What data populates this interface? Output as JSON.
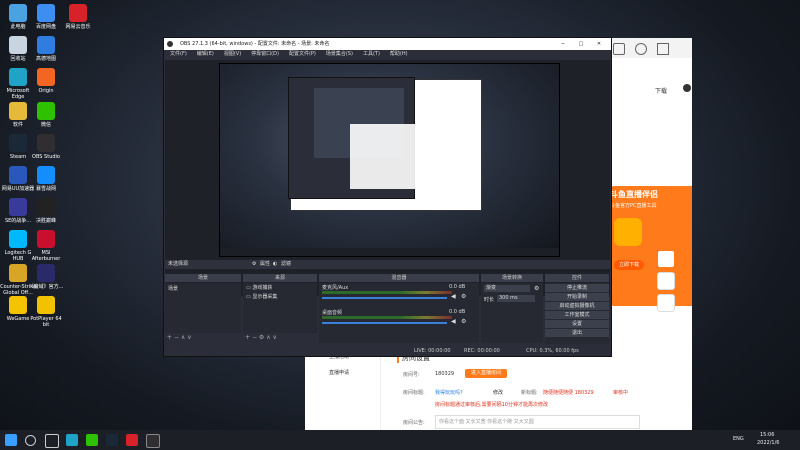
{
  "desktop_icons": [
    {
      "label": "此电脑",
      "color": "#4aa3e0"
    },
    {
      "label": "百度网盘",
      "color": "#3d8ef0"
    },
    {
      "label": "网易云音乐",
      "color": "#d8222a"
    },
    {
      "label": "回收站",
      "color": "#c8d4e0"
    },
    {
      "label": "高德地图",
      "color": "#2f7de1"
    },
    {
      "label": "Microsoft Edge",
      "color": "#1fa3c6"
    },
    {
      "label": "Origin",
      "color": "#f26522"
    },
    {
      "label": "软件",
      "color": "#e6b93a"
    },
    {
      "label": "微信",
      "color": "#2dc100"
    },
    {
      "label": "Steam",
      "color": "#1b2838"
    },
    {
      "label": "OBS Studio",
      "color": "#302e31"
    },
    {
      "label": "网易UU加速器",
      "color": "#2957ba"
    },
    {
      "label": "暴雪战网",
      "color": "#148eff"
    },
    {
      "label": "SE的战争...",
      "color": "#3a3a9a"
    },
    {
      "label": "决胜巅峰",
      "color": "#222222"
    },
    {
      "label": "Logitech G HUB",
      "color": "#00b8fc"
    },
    {
      "label": "MSI Afterburner",
      "color": "#c8102e"
    },
    {
      "label": "Counter-Strike Global Off...",
      "color": "#d8a526"
    },
    {
      "label": "《魔域》官方...",
      "color": "#2a2a6a"
    },
    {
      "label": "WeGame",
      "color": "#f5c400"
    },
    {
      "label": "PotPlayer 64 bit",
      "color": "#f2c200"
    }
  ],
  "obs": {
    "title": "OBS 27.1.3 (64-bit, windows) - 配置文件: 未命名 - 场景: 未命名",
    "menu": [
      "文件(F)",
      "编辑(E)",
      "视图(V)",
      "停靠窗口(D)",
      "配置文件(P)",
      "场景集合(S)",
      "工具(T)",
      "帮助(H)"
    ],
    "no_source_label": "未选择源",
    "props_btn": "属性",
    "filter_btn": "滤镜",
    "scenes_header": "场景",
    "scene_item": "场景",
    "sources_header": "来源",
    "sources": [
      "游戏捕获",
      "显示器采集"
    ],
    "mixer_header": "混音器",
    "mixer": [
      {
        "name": "麦克风/Aux",
        "db": "0.0 dB"
      },
      {
        "name": "桌面音频",
        "db": "0.0 dB"
      }
    ],
    "transitions_header": "场景转换",
    "transition_type": "渐变",
    "duration_label": "时长",
    "duration_value": "300 ms",
    "controls_header": "控件",
    "controls": [
      "停止推流",
      "开始录制",
      "启动虚拟摄像机",
      "工作室模式",
      "设置",
      "退出"
    ],
    "status": {
      "live": "LIVE: 00:00:00",
      "rec": "REC: 00:00:00",
      "cpu": "CPU: 0.3%, 60.00 fps"
    }
  },
  "browser": {
    "download_label": "下载",
    "banner_title": "斗鱼直播伴侣",
    "banner_sub": "斗鱼官方PC直播工具",
    "banner_btn": "立即下载",
    "sidebar": [
      "主播活动",
      "直播申请"
    ],
    "section_title": "房间设置",
    "room_no_label": "房间号:",
    "room_no": "180329",
    "enter_room_btn": "进入直播房间",
    "room_title_label": "房间标题:",
    "room_title_link": "我得玩玩吗?",
    "modify": "修改",
    "new_title_label": "新标题:",
    "new_title": "随便随便随便 180329",
    "review": "审核中",
    "warn": "房间标题通过审核后,需要间隔10分钟才能再次修改",
    "intro_label": "房间公告:",
    "intro_placeholder": "你看这个面 又长又宽 你看这个碗 又大又圆"
  },
  "taskbar": {
    "lang": "ENG",
    "time": "15:06",
    "date": "2022/1/6"
  }
}
